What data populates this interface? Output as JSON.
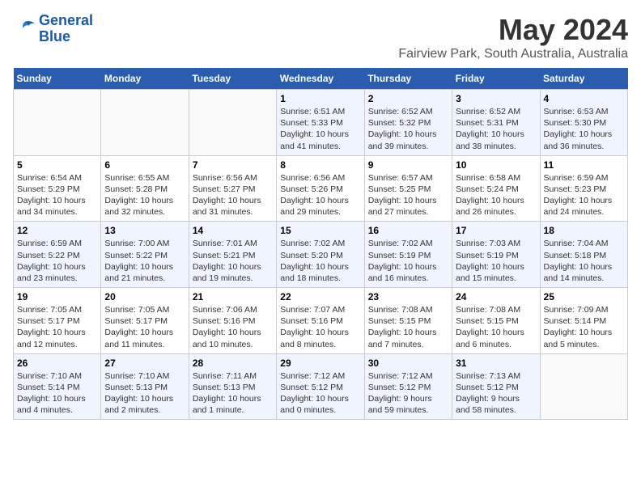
{
  "header": {
    "logo_line1": "General",
    "logo_line2": "Blue",
    "title": "May 2024",
    "subtitle": "Fairview Park, South Australia, Australia"
  },
  "days_of_week": [
    "Sunday",
    "Monday",
    "Tuesday",
    "Wednesday",
    "Thursday",
    "Friday",
    "Saturday"
  ],
  "weeks": [
    {
      "days": [
        {
          "num": "",
          "info": ""
        },
        {
          "num": "",
          "info": ""
        },
        {
          "num": "",
          "info": ""
        },
        {
          "num": "1",
          "info": "Sunrise: 6:51 AM\nSunset: 5:33 PM\nDaylight: 10 hours\nand 41 minutes."
        },
        {
          "num": "2",
          "info": "Sunrise: 6:52 AM\nSunset: 5:32 PM\nDaylight: 10 hours\nand 39 minutes."
        },
        {
          "num": "3",
          "info": "Sunrise: 6:52 AM\nSunset: 5:31 PM\nDaylight: 10 hours\nand 38 minutes."
        },
        {
          "num": "4",
          "info": "Sunrise: 6:53 AM\nSunset: 5:30 PM\nDaylight: 10 hours\nand 36 minutes."
        }
      ]
    },
    {
      "days": [
        {
          "num": "5",
          "info": "Sunrise: 6:54 AM\nSunset: 5:29 PM\nDaylight: 10 hours\nand 34 minutes."
        },
        {
          "num": "6",
          "info": "Sunrise: 6:55 AM\nSunset: 5:28 PM\nDaylight: 10 hours\nand 32 minutes."
        },
        {
          "num": "7",
          "info": "Sunrise: 6:56 AM\nSunset: 5:27 PM\nDaylight: 10 hours\nand 31 minutes."
        },
        {
          "num": "8",
          "info": "Sunrise: 6:56 AM\nSunset: 5:26 PM\nDaylight: 10 hours\nand 29 minutes."
        },
        {
          "num": "9",
          "info": "Sunrise: 6:57 AM\nSunset: 5:25 PM\nDaylight: 10 hours\nand 27 minutes."
        },
        {
          "num": "10",
          "info": "Sunrise: 6:58 AM\nSunset: 5:24 PM\nDaylight: 10 hours\nand 26 minutes."
        },
        {
          "num": "11",
          "info": "Sunrise: 6:59 AM\nSunset: 5:23 PM\nDaylight: 10 hours\nand 24 minutes."
        }
      ]
    },
    {
      "days": [
        {
          "num": "12",
          "info": "Sunrise: 6:59 AM\nSunset: 5:22 PM\nDaylight: 10 hours\nand 23 minutes."
        },
        {
          "num": "13",
          "info": "Sunrise: 7:00 AM\nSunset: 5:22 PM\nDaylight: 10 hours\nand 21 minutes."
        },
        {
          "num": "14",
          "info": "Sunrise: 7:01 AM\nSunset: 5:21 PM\nDaylight: 10 hours\nand 19 minutes."
        },
        {
          "num": "15",
          "info": "Sunrise: 7:02 AM\nSunset: 5:20 PM\nDaylight: 10 hours\nand 18 minutes."
        },
        {
          "num": "16",
          "info": "Sunrise: 7:02 AM\nSunset: 5:19 PM\nDaylight: 10 hours\nand 16 minutes."
        },
        {
          "num": "17",
          "info": "Sunrise: 7:03 AM\nSunset: 5:19 PM\nDaylight: 10 hours\nand 15 minutes."
        },
        {
          "num": "18",
          "info": "Sunrise: 7:04 AM\nSunset: 5:18 PM\nDaylight: 10 hours\nand 14 minutes."
        }
      ]
    },
    {
      "days": [
        {
          "num": "19",
          "info": "Sunrise: 7:05 AM\nSunset: 5:17 PM\nDaylight: 10 hours\nand 12 minutes."
        },
        {
          "num": "20",
          "info": "Sunrise: 7:05 AM\nSunset: 5:17 PM\nDaylight: 10 hours\nand 11 minutes."
        },
        {
          "num": "21",
          "info": "Sunrise: 7:06 AM\nSunset: 5:16 PM\nDaylight: 10 hours\nand 10 minutes."
        },
        {
          "num": "22",
          "info": "Sunrise: 7:07 AM\nSunset: 5:16 PM\nDaylight: 10 hours\nand 8 minutes."
        },
        {
          "num": "23",
          "info": "Sunrise: 7:08 AM\nSunset: 5:15 PM\nDaylight: 10 hours\nand 7 minutes."
        },
        {
          "num": "24",
          "info": "Sunrise: 7:08 AM\nSunset: 5:15 PM\nDaylight: 10 hours\nand 6 minutes."
        },
        {
          "num": "25",
          "info": "Sunrise: 7:09 AM\nSunset: 5:14 PM\nDaylight: 10 hours\nand 5 minutes."
        }
      ]
    },
    {
      "days": [
        {
          "num": "26",
          "info": "Sunrise: 7:10 AM\nSunset: 5:14 PM\nDaylight: 10 hours\nand 4 minutes."
        },
        {
          "num": "27",
          "info": "Sunrise: 7:10 AM\nSunset: 5:13 PM\nDaylight: 10 hours\nand 2 minutes."
        },
        {
          "num": "28",
          "info": "Sunrise: 7:11 AM\nSunset: 5:13 PM\nDaylight: 10 hours\nand 1 minute."
        },
        {
          "num": "29",
          "info": "Sunrise: 7:12 AM\nSunset: 5:12 PM\nDaylight: 10 hours\nand 0 minutes."
        },
        {
          "num": "30",
          "info": "Sunrise: 7:12 AM\nSunset: 5:12 PM\nDaylight: 9 hours\nand 59 minutes."
        },
        {
          "num": "31",
          "info": "Sunrise: 7:13 AM\nSunset: 5:12 PM\nDaylight: 9 hours\nand 58 minutes."
        },
        {
          "num": "",
          "info": ""
        }
      ]
    }
  ]
}
